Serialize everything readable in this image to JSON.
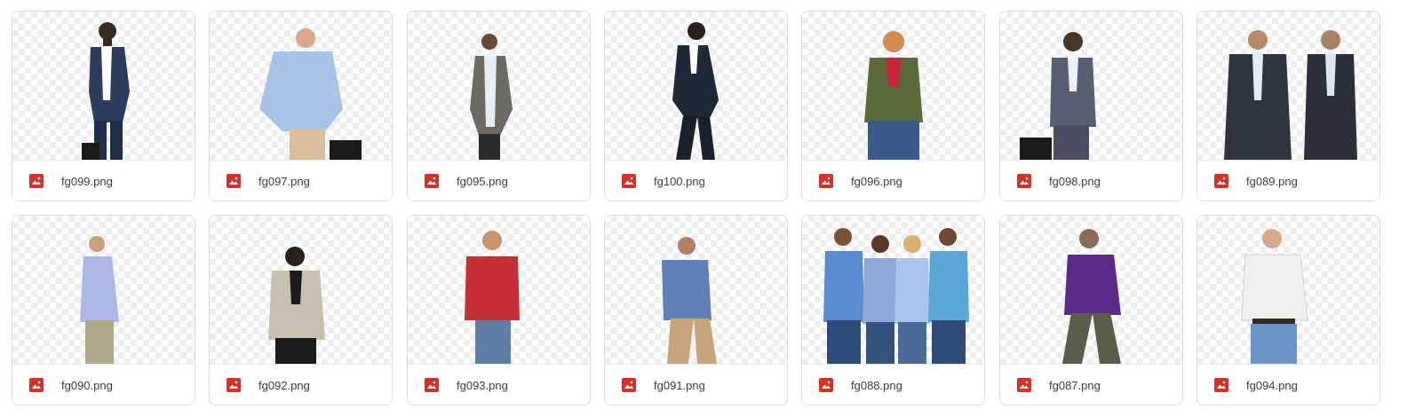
{
  "files": [
    {
      "name": "fg099.png"
    },
    {
      "name": "fg097.png"
    },
    {
      "name": "fg095.png"
    },
    {
      "name": "fg100.png"
    },
    {
      "name": "fg096.png"
    },
    {
      "name": "fg098.png"
    },
    {
      "name": "fg089.png"
    },
    {
      "name": "fg090.png"
    },
    {
      "name": "fg092.png"
    },
    {
      "name": "fg093.png"
    },
    {
      "name": "fg091.png"
    },
    {
      "name": "fg088.png"
    },
    {
      "name": "fg087.png"
    },
    {
      "name": "fg094.png"
    }
  ],
  "file_type_icon": "image-icon",
  "colors": {
    "file_icon": "#d93025",
    "border": "#dadce0",
    "text": "#3c4043"
  }
}
